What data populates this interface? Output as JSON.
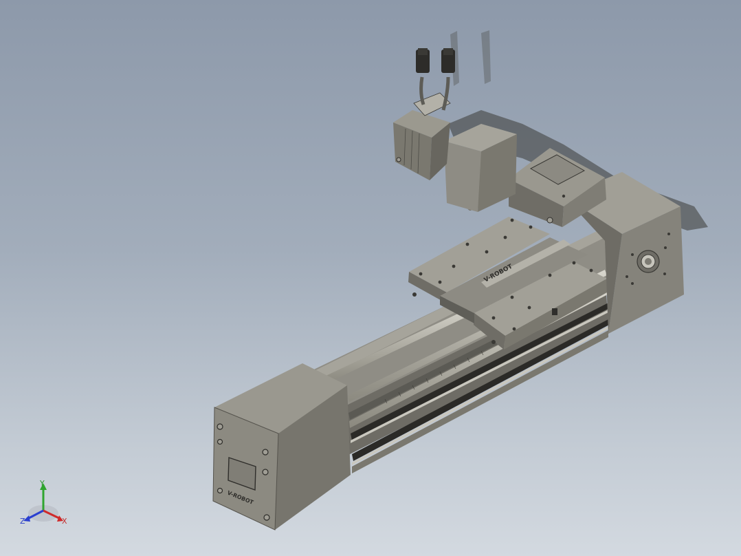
{
  "viewport": {
    "background_top": "#8d99aa",
    "background_bottom": "#d3d9e0"
  },
  "model": {
    "body_color": "#84827a",
    "shadow_color": "#3f3e3a",
    "carriage_logo_text": "V-ROBOT",
    "end_cap_logo_text": "V-ROBOT"
  },
  "triad": {
    "x_label": "X",
    "y_label": "Y",
    "z_label": "Z",
    "x_color": "#d02a2a",
    "y_color": "#2fa52f",
    "z_color": "#2a3fd0"
  }
}
